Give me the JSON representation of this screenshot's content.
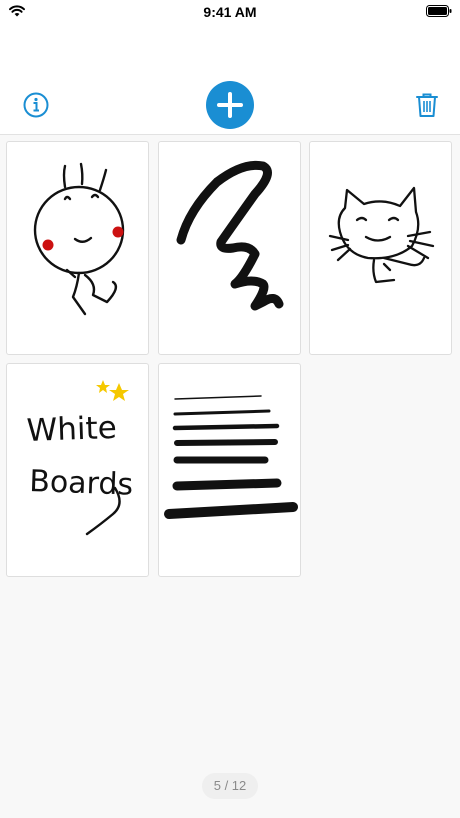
{
  "status_bar": {
    "time": "9:41 AM",
    "wifi_icon": "wifi-icon",
    "battery_icon": "battery-icon"
  },
  "toolbar": {
    "info_icon": "info-icon",
    "add_icon": "plus-icon",
    "trash_icon": "trash-icon",
    "accent_color": "#1a8ed3"
  },
  "boards": [
    {
      "content": "doodle of a smiling stick figure with red cheeks"
    },
    {
      "content": "black zigzag scribble"
    },
    {
      "content": "doodle of a smiling cat"
    },
    {
      "content": "handwritten text White Boards with two stars",
      "handwritten_text": "White Boards"
    },
    {
      "content": "horizontal pen strokes of increasing thickness"
    }
  ],
  "page_indicator": "5 / 12"
}
